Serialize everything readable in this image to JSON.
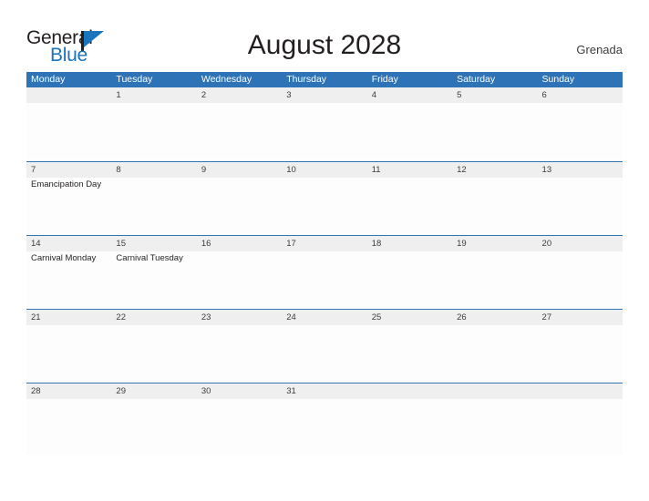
{
  "brand": {
    "name_part1": "General",
    "name_part2": "Blue",
    "triangle_color": "#1b75bc",
    "text_color": "#231f20"
  },
  "header": {
    "title": "August 2028",
    "country": "Grenada"
  },
  "calendar": {
    "header_bg": "#2e73b5",
    "band_bg": "#efefef",
    "row_border": "#2e73b5",
    "weekdays": [
      "Monday",
      "Tuesday",
      "Wednesday",
      "Thursday",
      "Friday",
      "Saturday",
      "Sunday"
    ],
    "weeks": [
      {
        "days": [
          {
            "num": "",
            "event": ""
          },
          {
            "num": "1",
            "event": ""
          },
          {
            "num": "2",
            "event": ""
          },
          {
            "num": "3",
            "event": ""
          },
          {
            "num": "4",
            "event": ""
          },
          {
            "num": "5",
            "event": ""
          },
          {
            "num": "6",
            "event": ""
          }
        ]
      },
      {
        "days": [
          {
            "num": "7",
            "event": "Emancipation Day"
          },
          {
            "num": "8",
            "event": ""
          },
          {
            "num": "9",
            "event": ""
          },
          {
            "num": "10",
            "event": ""
          },
          {
            "num": "11",
            "event": ""
          },
          {
            "num": "12",
            "event": ""
          },
          {
            "num": "13",
            "event": ""
          }
        ]
      },
      {
        "days": [
          {
            "num": "14",
            "event": "Carnival Monday"
          },
          {
            "num": "15",
            "event": "Carnival Tuesday"
          },
          {
            "num": "16",
            "event": ""
          },
          {
            "num": "17",
            "event": ""
          },
          {
            "num": "18",
            "event": ""
          },
          {
            "num": "19",
            "event": ""
          },
          {
            "num": "20",
            "event": ""
          }
        ]
      },
      {
        "days": [
          {
            "num": "21",
            "event": ""
          },
          {
            "num": "22",
            "event": ""
          },
          {
            "num": "23",
            "event": ""
          },
          {
            "num": "24",
            "event": ""
          },
          {
            "num": "25",
            "event": ""
          },
          {
            "num": "26",
            "event": ""
          },
          {
            "num": "27",
            "event": ""
          }
        ]
      },
      {
        "days": [
          {
            "num": "28",
            "event": ""
          },
          {
            "num": "29",
            "event": ""
          },
          {
            "num": "30",
            "event": ""
          },
          {
            "num": "31",
            "event": ""
          },
          {
            "num": "",
            "event": ""
          },
          {
            "num": "",
            "event": ""
          },
          {
            "num": "",
            "event": ""
          }
        ]
      }
    ]
  }
}
